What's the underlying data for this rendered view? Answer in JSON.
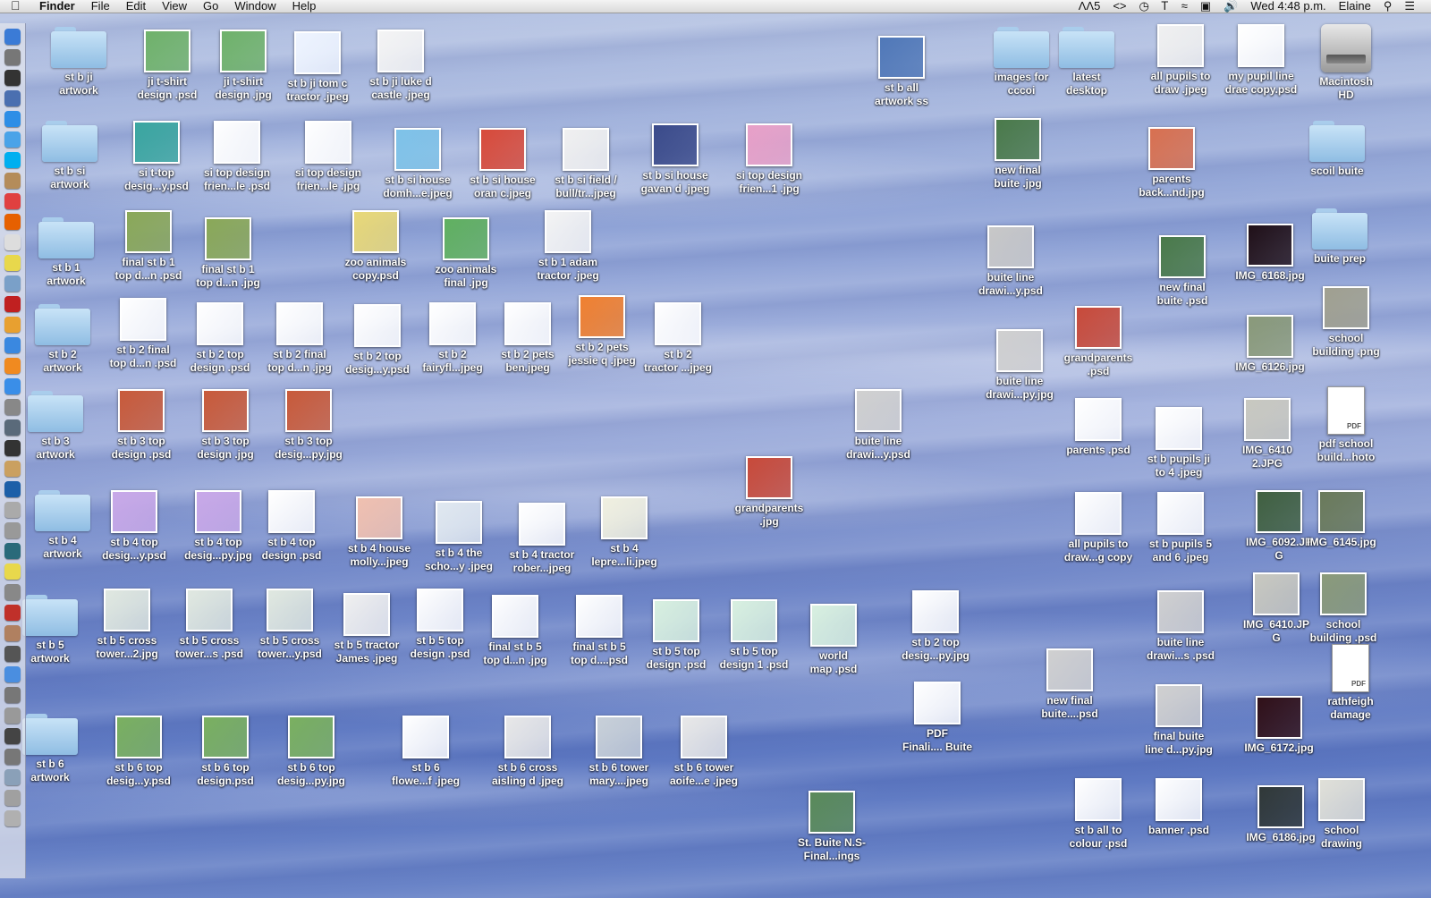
{
  "menubar": {
    "app": "Finder",
    "menus": [
      "File",
      "Edit",
      "View",
      "Go",
      "Window",
      "Help"
    ],
    "status": {
      "adobe": "5",
      "clock": "Wed 4:48 p.m.",
      "user": "Elaine"
    }
  },
  "dock": {
    "items": [
      {
        "icon": "finder-icon",
        "color": "#3b7bd6"
      },
      {
        "icon": "launchpad-icon",
        "color": "#777"
      },
      {
        "icon": "dashboard-icon",
        "color": "#333"
      },
      {
        "icon": "mission-control-icon",
        "color": "#4a6fb0"
      },
      {
        "icon": "safari-icon",
        "color": "#2e8ee6"
      },
      {
        "icon": "messages-icon",
        "color": "#4aa3e8"
      },
      {
        "icon": "skype-icon",
        "color": "#00aff0"
      },
      {
        "icon": "contacts-icon",
        "color": "#b48c5a"
      },
      {
        "icon": "calendar-icon",
        "color": "#e04040"
      },
      {
        "icon": "firefox-icon",
        "color": "#e66000"
      },
      {
        "icon": "textedit-icon",
        "color": "#ddd"
      },
      {
        "icon": "stickies-icon",
        "color": "#e8d84c"
      },
      {
        "icon": "preview-icon",
        "color": "#7aa0c8"
      },
      {
        "icon": "photo-booth-icon",
        "color": "#c02020"
      },
      {
        "icon": "pages-icon",
        "color": "#e8a030"
      },
      {
        "icon": "itunes-icon",
        "color": "#3a88e0"
      },
      {
        "icon": "ibooks-icon",
        "color": "#f08a20"
      },
      {
        "icon": "app-store-icon",
        "color": "#3a8ee8"
      },
      {
        "icon": "calculator-icon",
        "color": "#888"
      },
      {
        "icon": "iphoto-icon",
        "color": "#5a6a7a"
      },
      {
        "icon": "imovie-icon",
        "color": "#333"
      },
      {
        "icon": "garageband-icon",
        "color": "#caa060"
      },
      {
        "icon": "photoshop-icon",
        "color": "#1c5fa8"
      },
      {
        "icon": "preview2-icon",
        "color": "#aaa"
      },
      {
        "icon": "capture-icon",
        "color": "#999"
      },
      {
        "icon": "time-machine-icon",
        "color": "#2a6a7a"
      },
      {
        "icon": "stickies2-icon",
        "color": "#e8d84c"
      },
      {
        "icon": "system-preferences-icon",
        "color": "#888"
      },
      {
        "icon": "acrobat-icon",
        "color": "#c0302a"
      },
      {
        "icon": "image-capture-icon",
        "color": "#b08060"
      },
      {
        "icon": "utilities-icon",
        "color": "#555"
      },
      {
        "icon": "chrome-icon",
        "color": "#4a8ee0"
      },
      {
        "icon": "network-icon",
        "color": "#777"
      },
      {
        "icon": "printer-icon",
        "color": "#999"
      },
      {
        "icon": "camera-icon",
        "color": "#444"
      },
      {
        "icon": "downloads-icon",
        "color": "#777"
      },
      {
        "icon": "documents-icon",
        "color": "#8aa0b8"
      },
      {
        "icon": "stack-icon",
        "color": "#a0a0a0"
      },
      {
        "icon": "trash-icon",
        "color": "#b0b0b0"
      }
    ]
  },
  "icons": [
    {
      "label": "st b ji\nartwork",
      "kind": "folder"
    },
    {
      "label": "ji t-shirt\ndesign .psd",
      "kind": "thumb",
      "color": "#6fb26a"
    },
    {
      "label": "ji t-shirt\ndesign .jpg",
      "kind": "thumb",
      "color": "#6fb26a"
    },
    {
      "label": "st b ji tom c\ntractor .jpeg",
      "kind": "thumb",
      "color": "#eef4ff"
    },
    {
      "label": "st b ji luke d\ncastle .jpeg",
      "kind": "thumb",
      "color": "#f4f4f4"
    },
    {
      "label": "st b all\nartwork ss",
      "kind": "thumb",
      "color": "#5078b8"
    },
    {
      "label": "images for\ncccoi",
      "kind": "folder"
    },
    {
      "label": "latest\ndesktop",
      "kind": "folder"
    },
    {
      "label": "all pupils to\ndraw .jpeg",
      "kind": "thumb",
      "color": "#f0f0f0"
    },
    {
      "label": "my pupil line\ndrae copy.psd",
      "kind": "thumb",
      "color": "#ffffff"
    },
    {
      "label": "Macintosh\nHD",
      "kind": "hd"
    },
    {
      "label": "st b si\nartwork",
      "kind": "folder"
    },
    {
      "label": "si t-top\ndesig...y.psd",
      "kind": "thumb",
      "color": "#3aa6a0"
    },
    {
      "label": "si top design\nfrien...le .psd",
      "kind": "thumb",
      "color": "#ffffff"
    },
    {
      "label": "si top design\nfrien...le .jpg",
      "kind": "thumb",
      "color": "#ffffff"
    },
    {
      "label": "st b si house\ndomh...e.jpeg",
      "kind": "thumb",
      "color": "#7ec2e8"
    },
    {
      "label": "st b si house\noran c.jpeg",
      "kind": "thumb",
      "color": "#d84a3a"
    },
    {
      "label": "st b si field /\nbull/tr...jpeg",
      "kind": "thumb",
      "color": "#f0f0f0"
    },
    {
      "label": "st b si house\ngavan d .jpeg",
      "kind": "thumb",
      "color": "#3a4a8a"
    },
    {
      "label": "si top design\nfrien...1 .jpg",
      "kind": "thumb",
      "color": "#e8a0c8"
    },
    {
      "label": "new final\nbuite .jpg",
      "kind": "thumb",
      "color": "#4a7a4a"
    },
    {
      "label": "parents\nback...nd.jpg",
      "kind": "thumb",
      "color": "#d87050"
    },
    {
      "label": "scoil buite",
      "kind": "folder"
    },
    {
      "label": "st b 1\nartwork",
      "kind": "folder"
    },
    {
      "label": "final st b 1\ntop d...n .psd",
      "kind": "thumb",
      "color": "#8aa858"
    },
    {
      "label": "final st b 1\ntop d...n .jpg",
      "kind": "thumb",
      "color": "#8aa858"
    },
    {
      "label": "zoo animals\ncopy.psd",
      "kind": "thumb",
      "color": "#e8d878"
    },
    {
      "label": "zoo animals\nfinal .jpg",
      "kind": "thumb",
      "color": "#60b060"
    },
    {
      "label": "st b 1 adam\ntractor .jpeg",
      "kind": "thumb",
      "color": "#f4f4f4"
    },
    {
      "label": "buite line\ndrawi...y.psd",
      "kind": "thumb",
      "color": "#c8c8c8"
    },
    {
      "label": "new final\nbuite .psd",
      "kind": "thumb",
      "color": "#4a7a4a"
    },
    {
      "label": "IMG_6168.jpg",
      "kind": "thumb",
      "color": "#201018"
    },
    {
      "label": "buite prep",
      "kind": "folder"
    },
    {
      "label": "st b 2\nartwork",
      "kind": "folder"
    },
    {
      "label": "st b 2 final\ntop d...n .psd",
      "kind": "thumb",
      "color": "#ffffff"
    },
    {
      "label": "st b 2 top\ndesign .psd",
      "kind": "thumb",
      "color": "#ffffff"
    },
    {
      "label": "st b 2 final\ntop d...n .jpg",
      "kind": "thumb",
      "color": "#ffffff"
    },
    {
      "label": "st b 2 top\ndesig...y.psd",
      "kind": "thumb",
      "color": "#ffffff"
    },
    {
      "label": "st b 2\nfairyfl...jpeg",
      "kind": "thumb",
      "color": "#ffffff"
    },
    {
      "label": "st b 2 pets\nben.jpeg",
      "kind": "thumb",
      "color": "#ffffff"
    },
    {
      "label": "st b 2 pets\njessie q .jpeg",
      "kind": "thumb",
      "color": "#f08030"
    },
    {
      "label": "st b 2\ntractor ...jpeg",
      "kind": "thumb",
      "color": "#ffffff"
    },
    {
      "label": "grandparents\n.psd",
      "kind": "thumb",
      "color": "#c84a3a"
    },
    {
      "label": "buite line\ndrawi...py.jpg",
      "kind": "thumb",
      "color": "#d0d0d0"
    },
    {
      "label": "IMG_6126.jpg",
      "kind": "thumb",
      "color": "#8a9a7a"
    },
    {
      "label": "school\nbuilding .png",
      "kind": "thumb",
      "color": "#a0a090"
    },
    {
      "label": "st b 3\nartwork",
      "kind": "folder"
    },
    {
      "label": "st b 3 top\ndesign .psd",
      "kind": "thumb",
      "color": "#c85a3a"
    },
    {
      "label": "st b 3 top\ndesign .jpg",
      "kind": "thumb",
      "color": "#c85a3a"
    },
    {
      "label": "st b 3 top\ndesig...py.jpg",
      "kind": "thumb",
      "color": "#c85a3a"
    },
    {
      "label": "buite line\ndrawi...y.psd",
      "kind": "thumb",
      "color": "#d0d0d0"
    },
    {
      "label": "parents .psd",
      "kind": "thumb",
      "color": "#ffffff"
    },
    {
      "label": "st b pupils ji\nto 4 .jpeg",
      "kind": "thumb",
      "color": "#ffffff"
    },
    {
      "label": "IMG_6410\n2.JPG",
      "kind": "thumb",
      "color": "#c8c8c0"
    },
    {
      "label": "pdf school\nbuild...hoto",
      "kind": "pdf"
    },
    {
      "label": "grandparents\n.jpg",
      "kind": "thumb",
      "color": "#c84a3a"
    },
    {
      "label": "st b 4\nartwork",
      "kind": "folder"
    },
    {
      "label": "st b 4 top\ndesig...y.psd",
      "kind": "thumb",
      "color": "#c8a8e8"
    },
    {
      "label": "st b 4 top\ndesig...py.jpg",
      "kind": "thumb",
      "color": "#c8a8e8"
    },
    {
      "label": "st b 4 top\ndesign .psd",
      "kind": "thumb",
      "color": "#ffffff"
    },
    {
      "label": "st b 4 house\nmolly...jpeg",
      "kind": "thumb",
      "color": "#f0c0b0"
    },
    {
      "label": "st b 4 the\nscho...y .jpeg",
      "kind": "thumb",
      "color": "#e0e8f0"
    },
    {
      "label": "st b 4 tractor\nrober...jpeg",
      "kind": "thumb",
      "color": "#ffffff"
    },
    {
      "label": "st b 4\nlepre...li.jpeg",
      "kind": "thumb",
      "color": "#f0f0e0"
    },
    {
      "label": "all pupils to\ndraw...g copy",
      "kind": "thumb",
      "color": "#ffffff"
    },
    {
      "label": "st b pupils 5\nand 6 .jpeg",
      "kind": "thumb",
      "color": "#ffffff"
    },
    {
      "label": "IMG_6092.JP\nG",
      "kind": "thumb",
      "color": "#406040"
    },
    {
      "label": "IMG_6145.jpg",
      "kind": "thumb",
      "color": "#6a7a5a"
    },
    {
      "label": "st b 5\nartwork",
      "kind": "folder"
    },
    {
      "label": "st b 5 cross\ntower...2.jpg",
      "kind": "thumb",
      "color": "#e0e8e0"
    },
    {
      "label": "st b 5 cross\ntower...s .psd",
      "kind": "thumb",
      "color": "#e0e8e0"
    },
    {
      "label": "st b 5 cross\ntower...y.psd",
      "kind": "thumb",
      "color": "#e0e8e0"
    },
    {
      "label": "st b 5 tractor\nJames .jpeg",
      "kind": "thumb",
      "color": "#f0f0f0"
    },
    {
      "label": "st b 5 top\ndesign .psd",
      "kind": "thumb",
      "color": "#ffffff"
    },
    {
      "label": "final st b 5\ntop d...n .jpg",
      "kind": "thumb",
      "color": "#ffffff"
    },
    {
      "label": "final st b 5\ntop d....psd",
      "kind": "thumb",
      "color": "#ffffff"
    },
    {
      "label": "st b 5 top\ndesign .psd",
      "kind": "thumb",
      "color": "#d8f0e0"
    },
    {
      "label": "st b 5 top\ndesign 1 .psd",
      "kind": "thumb",
      "color": "#d8f0e0"
    },
    {
      "label": "world\nmap .psd",
      "kind": "thumb",
      "color": "#d8f0e0"
    },
    {
      "label": "st b 2 top\ndesig...py.jpg",
      "kind": "thumb",
      "color": "#ffffff"
    },
    {
      "label": "buite line\ndrawi...s .psd",
      "kind": "thumb",
      "color": "#d0d0d0"
    },
    {
      "label": "IMG_6410.JP\nG",
      "kind": "thumb",
      "color": "#c8c8c0"
    },
    {
      "label": "school\nbuilding .psd",
      "kind": "thumb",
      "color": "#8a9a7a"
    },
    {
      "label": "new final\nbuite....psd",
      "kind": "thumb",
      "color": "#d0d0d0"
    },
    {
      "label": "PDF\nFinali.... Buite",
      "kind": "thumb",
      "color": "#ffffff"
    },
    {
      "label": "rathfeigh\ndamage",
      "kind": "pdf"
    },
    {
      "label": "st b 6\nartwork",
      "kind": "folder"
    },
    {
      "label": "st b 6 top\ndesig...y.psd",
      "kind": "thumb",
      "color": "#7ab060"
    },
    {
      "label": "st b 6 top\ndesign.psd",
      "kind": "thumb",
      "color": "#7ab060"
    },
    {
      "label": "st b 6 top\ndesig...py.jpg",
      "kind": "thumb",
      "color": "#7ab060"
    },
    {
      "label": "st b 6\nflowe...f .jpeg",
      "kind": "thumb",
      "color": "#ffffff"
    },
    {
      "label": "st b 6 cross\naisling d .jpeg",
      "kind": "thumb",
      "color": "#e8e8e8"
    },
    {
      "label": "st b 6 tower\nmary....jpeg",
      "kind": "thumb",
      "color": "#c8d0d8"
    },
    {
      "label": "st b 6 tower\naoife...e .jpeg",
      "kind": "thumb",
      "color": "#e8e8e8"
    },
    {
      "label": "final buite\nline d...py.jpg",
      "kind": "thumb",
      "color": "#d0d0d0"
    },
    {
      "label": "IMG_6172.jpg",
      "kind": "thumb",
      "color": "#301018"
    },
    {
      "label": "St. Buite N.S-\nFinal...ings",
      "kind": "thumb",
      "color": "#5a8a5a"
    },
    {
      "label": "st b all to\ncolour .psd",
      "kind": "thumb",
      "color": "#ffffff"
    },
    {
      "label": "banner .psd",
      "kind": "thumb",
      "color": "#ffffff"
    },
    {
      "label": "IMG_6186.jpg",
      "kind": "thumb",
      "color": "#303838"
    },
    {
      "label": "school\ndrawing",
      "kind": "thumb",
      "color": "#e0e0d8"
    }
  ]
}
